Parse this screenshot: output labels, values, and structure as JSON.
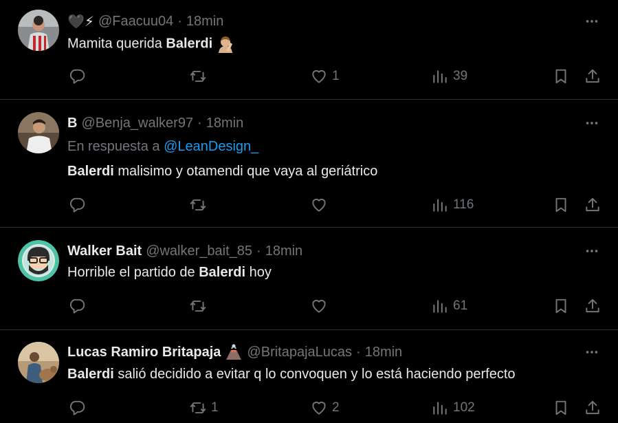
{
  "tweets": [
    {
      "name": "🖤⚡",
      "handle": "@Faacuu04",
      "dot": "·",
      "time": "18min",
      "text_plain": "Mamita querida ",
      "text_bold": "Balerdi",
      "text_after": "",
      "emoji": "person-facepalming",
      "stats": {
        "reply": "",
        "retweet": "",
        "like": "1",
        "views": "39"
      }
    },
    {
      "name": "B",
      "handle": "@Benja_walker97",
      "dot": "·",
      "time": "18min",
      "reply_prefix": "En respuesta a ",
      "reply_mention": "@LeanDesign_",
      "text_bold": "Balerdi",
      "text_after": " malisimo y otamendi que vaya al geriátrico",
      "stats": {
        "reply": "",
        "retweet": "",
        "like": "",
        "views": "116"
      }
    },
    {
      "name": "Walker Bait",
      "handle": "@walker_bait_85",
      "dot": "·",
      "time": "18min",
      "text_plain": "Horrible el partido de ",
      "text_bold": "Balerdi",
      "text_after": " hoy",
      "stats": {
        "reply": "",
        "retweet": "",
        "like": "",
        "views": "61"
      }
    },
    {
      "name": "Lucas Ramiro Britapaja",
      "name_emoji": "volcano",
      "handle": "@BritapajaLucas",
      "dot": "·",
      "time": "18min",
      "text_bold": "Balerdi",
      "text_after": " salió decidido a evitar q lo convoquen y lo está haciendo perfecto",
      "stats": {
        "reply": "",
        "retweet": "1",
        "like": "2",
        "views": "102"
      }
    }
  ],
  "colors": {
    "background": "#000000",
    "text": "#e7e9ea",
    "muted": "#71767b",
    "link": "#1d9bf0",
    "divider": "#2f3336"
  }
}
